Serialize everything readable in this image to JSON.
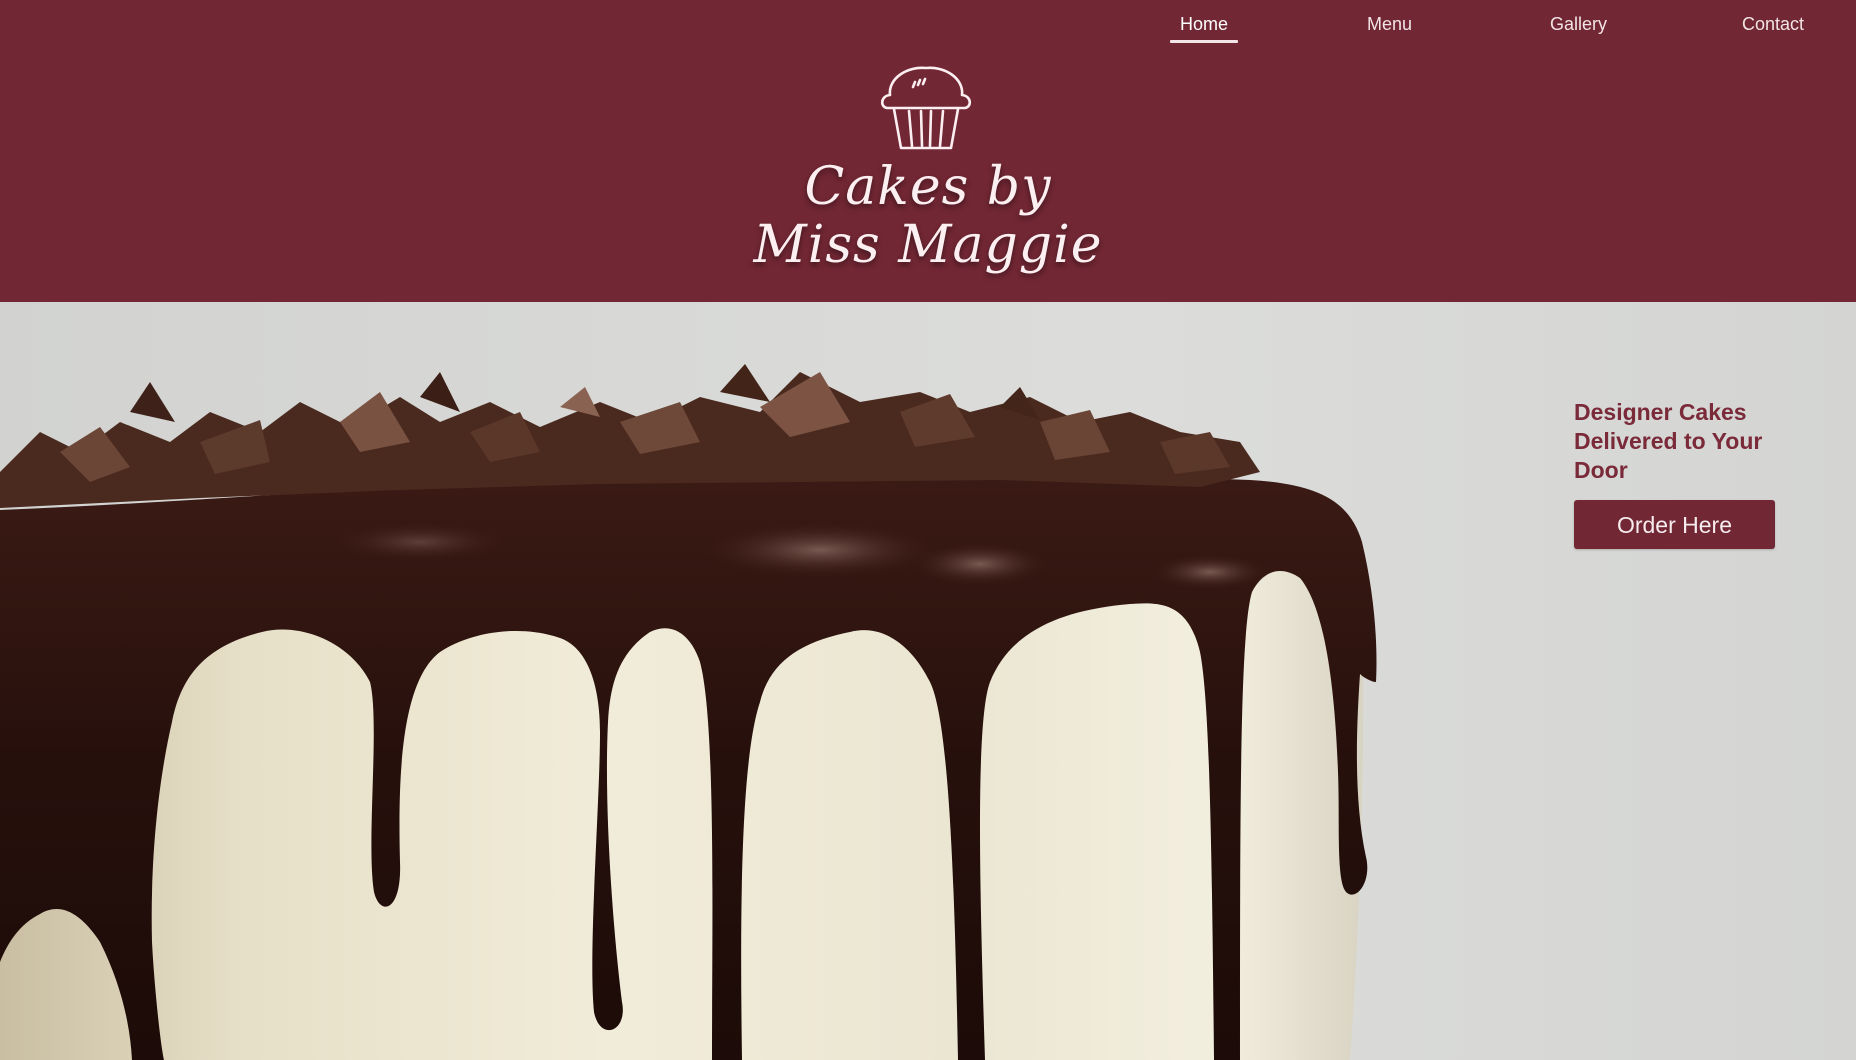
{
  "nav": {
    "items": [
      {
        "label": "Home",
        "active": true
      },
      {
        "label": "Menu",
        "active": false
      },
      {
        "label": "Gallery",
        "active": false
      },
      {
        "label": "Contact",
        "active": false
      }
    ]
  },
  "logo": {
    "icon": "cupcake-icon",
    "brand_line1": "Cakes by",
    "brand_line2": "Miss Maggie"
  },
  "hero": {
    "image": "chocolate-drip-cake",
    "heading": "Designer Cakes Delivered to Your Door",
    "order_button": "Order Here"
  },
  "colors": {
    "brand": "#722734",
    "header_text": "#f2e4e6",
    "hero_background": "#d8d9d7",
    "heading_text": "#7a2a38"
  }
}
